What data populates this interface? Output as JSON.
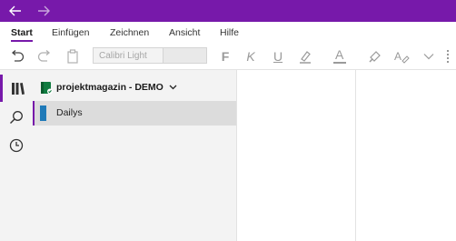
{
  "titlebar": {
    "back_icon": "arrow-left-icon",
    "forward_icon": "arrow-right-icon",
    "color": "#7719aa"
  },
  "ribbon": {
    "tabs": [
      {
        "label": "Start",
        "active": true
      },
      {
        "label": "Einfügen",
        "active": false
      },
      {
        "label": "Zeichnen",
        "active": false
      },
      {
        "label": "Ansicht",
        "active": false
      },
      {
        "label": "Hilfe",
        "active": false
      }
    ]
  },
  "toolbar": {
    "font_name": "Calibri Light",
    "font_size": "",
    "bold_glyph": "F",
    "italic_glyph": "K",
    "underline_glyph": "U",
    "font_color_glyph": "A",
    "icons": [
      "undo-icon",
      "redo-icon",
      "clipboard-icon",
      "highlighter-icon",
      "font-color-icon",
      "format-painter-icon",
      "clear-format-icon",
      "chevron-down-icon"
    ]
  },
  "rail": {
    "icons": [
      "notebooks-icon",
      "search-icon",
      "recent-icon"
    ]
  },
  "notebook": {
    "name": "projektmagazin - DEMO",
    "sections": [
      {
        "label": "Dailys",
        "color": "#1f7ab8"
      }
    ]
  }
}
